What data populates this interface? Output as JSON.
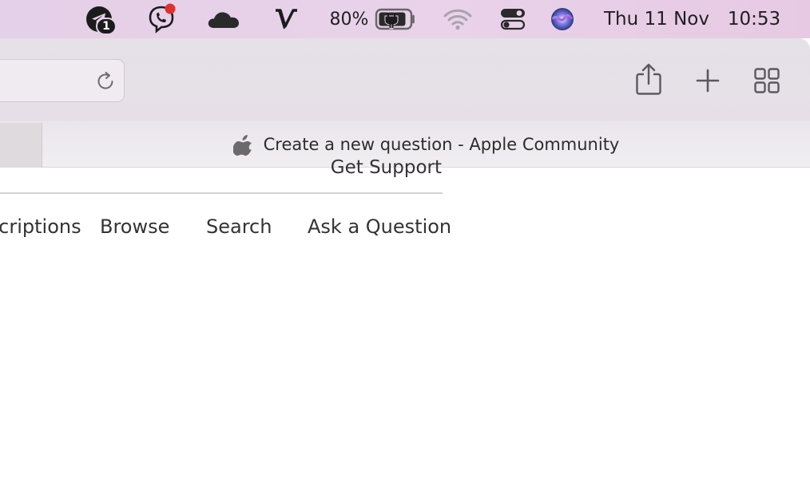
{
  "menubar": {
    "notification_count": "1",
    "battery_percent": "80%",
    "date": "Thu 11 Nov",
    "time": "10:53"
  },
  "browser": {
    "active_tab_title": "Create a new question - Apple Community"
  },
  "page": {
    "header_link": "Get Support",
    "nav": [
      {
        "label": "Subscriptions"
      },
      {
        "label": "Browse"
      },
      {
        "label": "Search"
      },
      {
        "label": "Ask a Question"
      }
    ]
  }
}
